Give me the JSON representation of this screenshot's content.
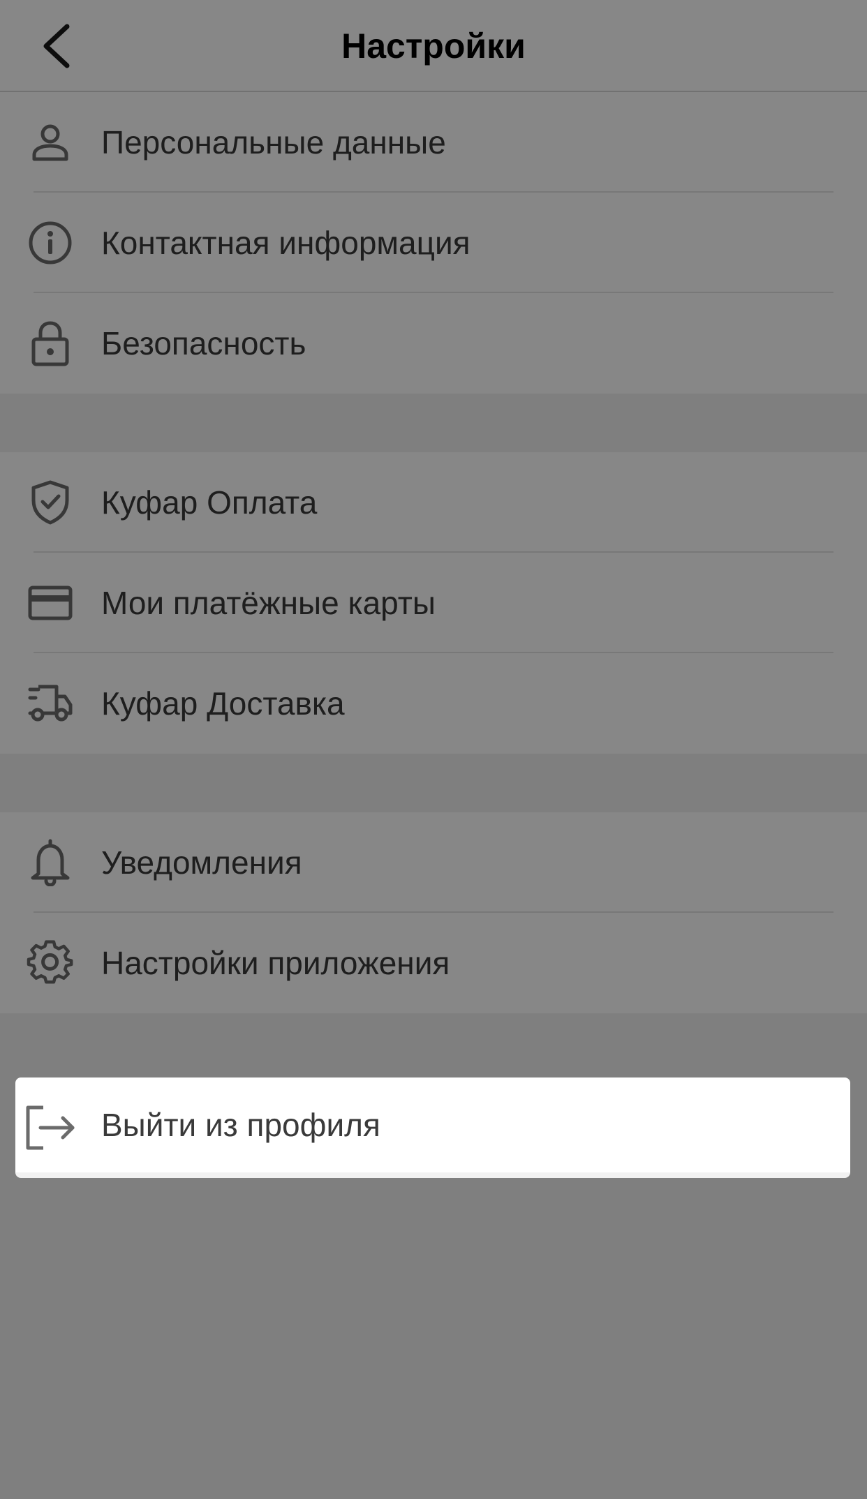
{
  "header": {
    "title": "Настройки",
    "back_icon": "chevron-left-icon"
  },
  "groups": [
    {
      "items": [
        {
          "label": "Персональные данные",
          "icon": "person-icon"
        },
        {
          "label": "Контактная информация",
          "icon": "info-icon"
        },
        {
          "label": "Безопасность",
          "icon": "lock-icon"
        }
      ]
    },
    {
      "items": [
        {
          "label": "Куфар Оплата",
          "icon": "shield-check-icon"
        },
        {
          "label": "Мои платёжные карты",
          "icon": "credit-card-icon"
        },
        {
          "label": "Куфар Доставка",
          "icon": "delivery-truck-icon"
        }
      ]
    },
    {
      "items": [
        {
          "label": "Уведомления",
          "icon": "bell-icon"
        },
        {
          "label": "Настройки приложения",
          "icon": "gear-icon"
        }
      ]
    }
  ],
  "logout": {
    "label": "Выйти из профиля",
    "icon": "logout-icon"
  },
  "colors": {
    "background": "#ffffff",
    "section_gap": "#f0f0f0",
    "icon_color": "#6b6b6b",
    "overlay": "rgba(0,0,0,0.47)"
  }
}
